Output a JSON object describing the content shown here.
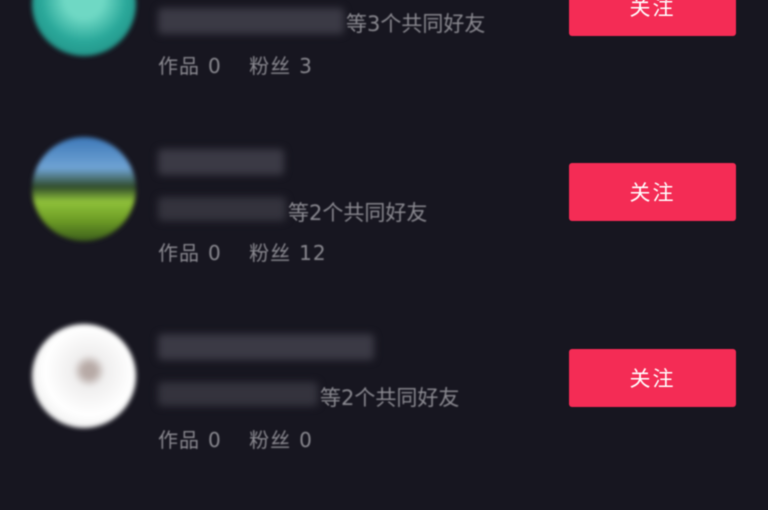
{
  "users": [
    {
      "mutual": "等3个共同好友",
      "works_label": "作品",
      "works": "0",
      "fans_label": "粉丝",
      "fans": "3",
      "follow_label": "关注"
    },
    {
      "mutual": "等2个共同好友",
      "works_label": "作品",
      "works": "0",
      "fans_label": "粉丝",
      "fans": "12",
      "follow_label": "关注"
    },
    {
      "mutual": "等2个共同好友",
      "works_label": "作品",
      "works": "0",
      "fans_label": "粉丝",
      "fans": "0",
      "follow_label": "关注"
    }
  ],
  "colors": {
    "background": "#171620",
    "follow_button": "#f42c55",
    "secondary_text": "#8a8990"
  }
}
